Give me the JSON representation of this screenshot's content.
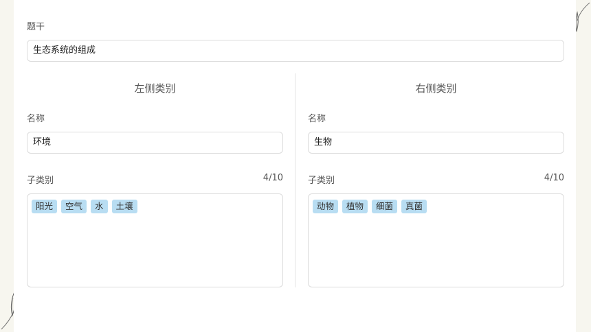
{
  "stem": {
    "label": "题干",
    "value": "生态系统的组成"
  },
  "left": {
    "title": "左侧类别",
    "name_label": "名称",
    "name_value": "环境",
    "sub_label": "子类别",
    "count": "4/10",
    "tags": [
      "阳光",
      "空气",
      "水",
      "土壤"
    ]
  },
  "right": {
    "title": "右侧类别",
    "name_label": "名称",
    "name_value": "生物",
    "sub_label": "子类别",
    "count": "4/10",
    "tags": [
      "动物",
      "植物",
      "细菌",
      "真菌"
    ]
  },
  "colors": {
    "tag_bg": "#b8ddf2",
    "page_bg": "#f7f6ef"
  }
}
